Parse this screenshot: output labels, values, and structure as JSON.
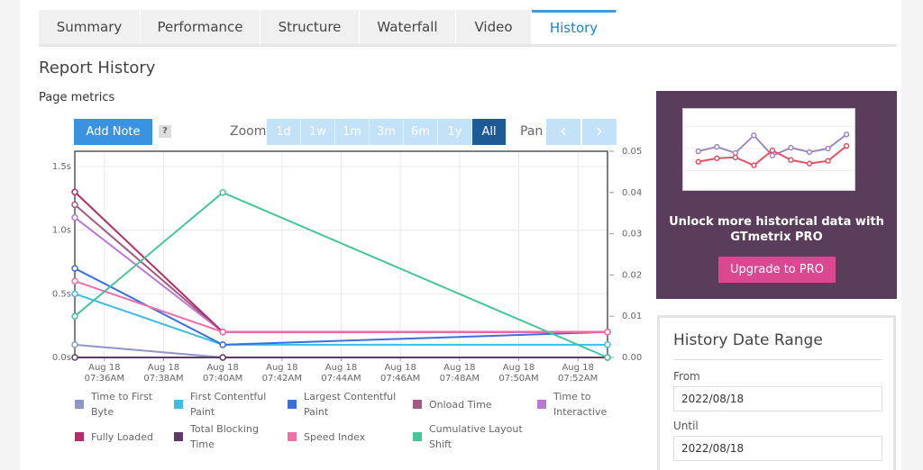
{
  "tabs": [
    {
      "label": "Summary",
      "width": 113
    },
    {
      "label": "Performance",
      "width": 133
    },
    {
      "label": "Structure",
      "width": 110
    },
    {
      "label": "Waterfall",
      "width": 107
    },
    {
      "label": "Video",
      "width": 84
    },
    {
      "label": "History",
      "width": 94,
      "active": true
    }
  ],
  "report_title": "Report History",
  "section_title": "Page metrics",
  "toolbar": {
    "add_note_label": "Add Note",
    "help_label": "?",
    "zoom_label": "Zoom",
    "zoom_options": [
      "1d",
      "1w",
      "1m",
      "3m",
      "6m",
      "1y",
      "All"
    ],
    "zoom_selected": "All",
    "pan_label": "Pan"
  },
  "chart_data": {
    "type": "line",
    "x_tick_labels": [
      [
        "Aug 18",
        "07:36AM"
      ],
      [
        "Aug 18",
        "07:38AM"
      ],
      [
        "Aug 18",
        "07:40AM"
      ],
      [
        "Aug 18",
        "07:42AM"
      ],
      [
        "Aug 18",
        "07:44AM"
      ],
      [
        "Aug 18",
        "07:46AM"
      ],
      [
        "Aug 18",
        "07:48AM"
      ],
      [
        "Aug 18",
        "07:50AM"
      ],
      [
        "Aug 18",
        "07:52AM"
      ]
    ],
    "x_range": [
      "07:35AM",
      "07:53AM"
    ],
    "x_points": [
      "07:35AM",
      "07:40AM",
      "07:53AM"
    ],
    "y_left": {
      "ticks": [
        "0.0s",
        "0.5s",
        "1.0s",
        "1.5s"
      ],
      "range": [
        0,
        1.5
      ],
      "unit": "s"
    },
    "y_right": {
      "ticks": [
        "0.00",
        "0.01",
        "0.02",
        "0.03",
        "0.04",
        "0.05"
      ],
      "range": [
        0,
        0.05
      ]
    },
    "grid": true,
    "series": [
      {
        "name": "Time to First Byte",
        "color": "#8e96c7",
        "axis": "left",
        "values": [
          0.1,
          0.0,
          0.0
        ]
      },
      {
        "name": "First Contentful Paint",
        "color": "#3fbbe8",
        "axis": "left",
        "values": [
          0.5,
          0.1,
          0.1
        ]
      },
      {
        "name": "Largest Contentful Paint",
        "color": "#3a6fdc",
        "axis": "left",
        "values": [
          0.7,
          0.1,
          0.2
        ]
      },
      {
        "name": "Onload Time",
        "color": "#a15b80",
        "axis": "left",
        "values": [
          1.2,
          0.2,
          0.2
        ]
      },
      {
        "name": "Time to Interactive",
        "color": "#b978d6",
        "axis": "left",
        "values": [
          1.1,
          0.2,
          0.2
        ]
      },
      {
        "name": "Fully Loaded",
        "color": "#b52d62",
        "axis": "left",
        "values": [
          1.3,
          0.2,
          0.2
        ]
      },
      {
        "name": "Total Blocking Time",
        "color": "#5e3a6a",
        "axis": "left",
        "values": [
          0.0,
          0.0,
          0.0
        ]
      },
      {
        "name": "Speed Index",
        "color": "#ee6fa8",
        "axis": "left",
        "values": [
          0.6,
          0.2,
          0.2
        ]
      },
      {
        "name": "Cumulative Layout Shift",
        "color": "#48c49a",
        "axis": "right",
        "values": [
          0.01,
          0.04,
          0.0
        ]
      }
    ]
  },
  "promo": {
    "line1": "Unlock more historical data with",
    "line2": "GTmetrix PRO",
    "button_label": "Upgrade to PRO"
  },
  "date_range": {
    "title": "History Date Range",
    "from_label": "From",
    "from_value": "2022/08/18",
    "until_label": "Until",
    "until_value": "2022/08/18"
  }
}
